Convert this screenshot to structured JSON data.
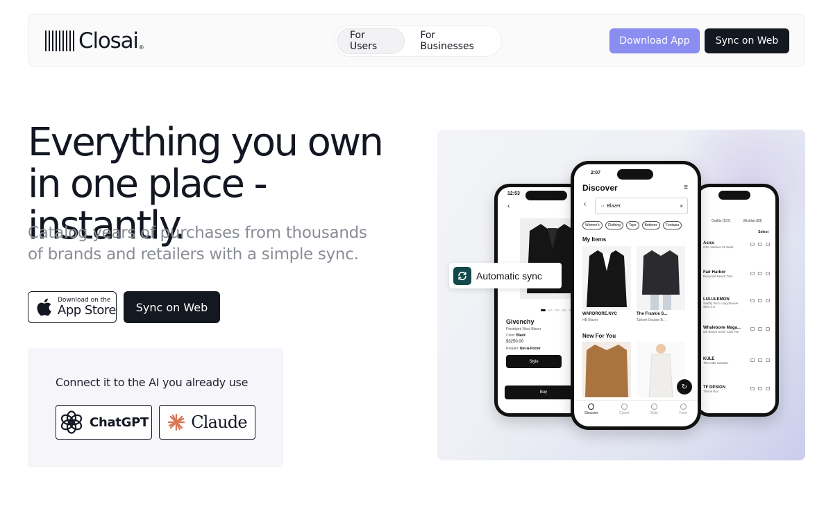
{
  "brand": {
    "name": "Closai",
    "mark": "®"
  },
  "nav": {
    "segment": [
      {
        "label": "For Users",
        "active": true
      },
      {
        "label": "For Businesses",
        "active": false
      }
    ],
    "download_label": "Download App",
    "sync_label": "Sync on Web"
  },
  "hero": {
    "title": "Everything you own in one place - instantly.",
    "subtitle": "Catalog years of purchases from thousands of brands and retailers with a simple sync.",
    "appstore_small": "Download on the",
    "appstore_big": "App Store",
    "sync_label": "Sync on Web"
  },
  "ai": {
    "title": "Connect it to the AI you already use",
    "chatgpt_label": "ChatGPT",
    "claude_label": "Claude"
  },
  "visual": {
    "sync_chip": "Automatic sync",
    "left_phone": {
      "time": "12:53",
      "brand": "Givenchy",
      "product": "Pinstriped Wool Blazer",
      "color_label": "Color:",
      "color": "Black",
      "price": "$3250.00",
      "retailer_label": "Retailer:",
      "retailer": "Net-A-Porter",
      "style_btn": "Style",
      "buy_btn": "Buy"
    },
    "center_phone": {
      "time": "2:07",
      "title": "Discover",
      "search": "Blazer",
      "chips": [
        "Women's",
        "Clothing",
        "Tops",
        "Bottoms",
        "Footwea"
      ],
      "my_items": "My Items",
      "items": [
        {
          "name": "WARDRORE.NYC",
          "sub": "HB Blazer"
        },
        {
          "name": "The Frankie S...",
          "sub": "Tarbert Double-B..."
        }
      ],
      "new_for_you": "New For You",
      "tabs": [
        "Discover",
        "Closet",
        "Style",
        "Feed"
      ]
    },
    "right_phone": {
      "tabs": [
        "Outfits (537)",
        "Wishlist (83)"
      ],
      "select": "Select",
      "rows": [
        {
          "brand": "Asics",
          "sub": "GEL-Nimbus 26 Wide"
        },
        {
          "brand": "Fair Harbor",
          "sub": "Recycled Beach Tote"
        },
        {
          "brand": "LULULEMON",
          "sub": "Swiftly Tech Long-Sleeve Shirt 2.0"
        },
        {
          "brand": "Whalebone Maga...",
          "sub": "6th Beach Swim Club Tee"
        },
        {
          "brand": "KULE",
          "sub": "The Little Sweater"
        },
        {
          "brand": "TF DESIGN",
          "sub": "Tissue Box"
        }
      ]
    }
  }
}
